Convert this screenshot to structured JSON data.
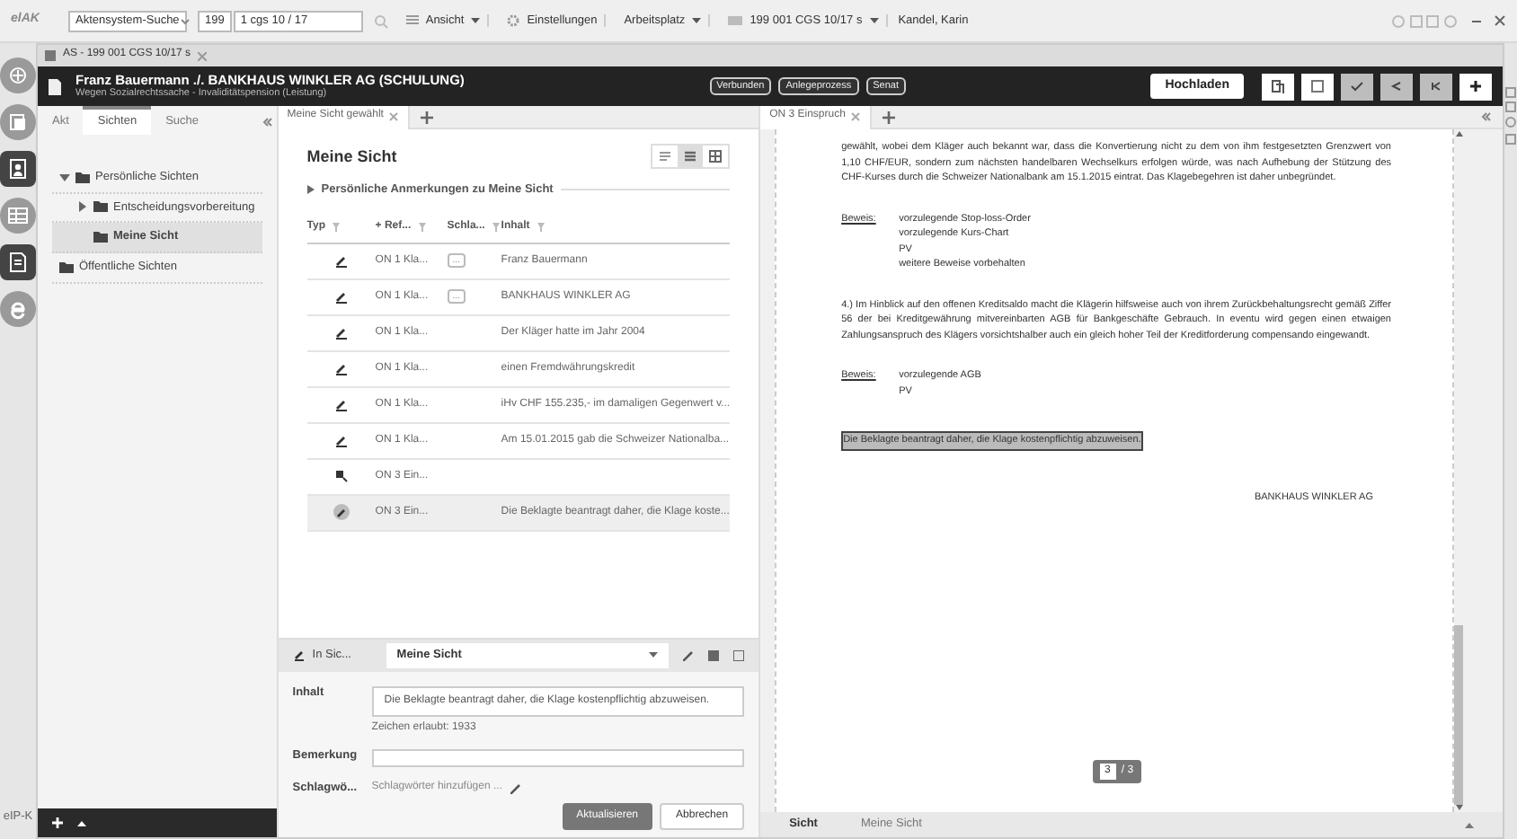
{
  "toolbar": {
    "logo": "elAK",
    "search_scope": "Aktensystem-Suche",
    "number": "199",
    "query": "1 cgs 10 / 17",
    "menus": [
      {
        "label": "Ansicht",
        "kind": "view",
        "dropdown": true
      },
      {
        "label": "Einstellungen",
        "kind": "settings",
        "dropdown": false
      },
      {
        "label": "Arbeitsplatz",
        "kind": "plain",
        "dropdown": true
      },
      {
        "label": "199 001 CGS 10/17 s",
        "kind": "file",
        "dropdown": true
      }
    ],
    "user": "Kandel, Karin"
  },
  "rail": {
    "items": [
      {
        "kind": "emblem",
        "selected": false
      },
      {
        "kind": "files",
        "selected": false
      },
      {
        "kind": "person",
        "selected": true
      },
      {
        "kind": "table",
        "selected": false
      },
      {
        "kind": "document",
        "selected": true
      },
      {
        "kind": "browser",
        "selected": false
      }
    ],
    "footer": "eIP-K"
  },
  "case_tab": "AS - 199 001 CGS 10/17 s",
  "header": {
    "title": "Franz Bauermann  ./.  BANKHAUS WINKLER AG (SCHULUNG)",
    "subtitle": "Wegen Sozialrechtssache - Invaliditätspension (Leistung)",
    "tags": [
      "Verbunden",
      "Anlegeprozess",
      "Senat"
    ],
    "upload": "Hochladen"
  },
  "left_panel": {
    "tabs": [
      {
        "label": "Akt",
        "selected": false
      },
      {
        "label": "Sichten",
        "selected": true
      },
      {
        "label": "Suche",
        "selected": false
      }
    ],
    "tree": [
      {
        "label": "Persönliche Sichten",
        "expandable": true,
        "expanded": true,
        "selected": false,
        "children": [
          {
            "label": "Entscheidungsvorbereitung",
            "expandable": true,
            "expanded": false,
            "selected": false
          },
          {
            "label": "Meine Sicht",
            "expandable": false,
            "selected": true
          }
        ]
      },
      {
        "label": "Öffentliche Sichten",
        "expandable": false,
        "selected": false
      }
    ]
  },
  "middle": {
    "tab": "Meine Sicht gewählt",
    "title": "Meine Sicht",
    "view_modes": [
      {
        "kind": "list",
        "selected": false
      },
      {
        "kind": "compact",
        "selected": true
      },
      {
        "kind": "grid",
        "selected": false
      }
    ],
    "section": "Persönliche Anmerkungen zu Meine Sicht",
    "columns": [
      "Typ",
      "+ Ref...",
      "Schla...",
      "Inhalt"
    ],
    "rows": [
      {
        "kind": "note",
        "ref": "ON 1 Kla...",
        "tag": "...",
        "content": "Franz Bauermann",
        "selected": false
      },
      {
        "kind": "note",
        "ref": "ON 1 Kla...",
        "tag": "...",
        "content": "BANKHAUS WINKLER AG",
        "selected": false
      },
      {
        "kind": "note",
        "ref": "ON 1 Kla...",
        "content": "Der Kläger hatte im Jahr 2004",
        "selected": false
      },
      {
        "kind": "note",
        "ref": "ON 1 Kla...",
        "content": "einen Fremdwährungskredit",
        "selected": false
      },
      {
        "kind": "note",
        "ref": "ON 1 Kla...",
        "content": "iHv CHF 155.235,- im damaligen Gegenwert v...",
        "selected": false
      },
      {
        "kind": "note",
        "ref": "ON 1 Kla...",
        "content": "Am 15.01.2015 gab die Schweizer Nationalba...",
        "selected": false
      },
      {
        "kind": "marker",
        "ref": "ON 3 Ein...",
        "selected": false
      },
      {
        "kind": "note",
        "ref": "ON 3 Ein...",
        "content": "Die Beklagte beantragt daher, die Klage koste...",
        "selected": true
      }
    ]
  },
  "editor": {
    "view_label": "In Sic...",
    "view": "Meine Sicht",
    "fields": [
      {
        "label": "Inhalt",
        "value": "Die Beklagte beantragt daher, die Klage kostenpflichtig abzuweisen.",
        "hint": "Zeichen erlaubt: 1933"
      },
      {
        "label": "Bemerkung"
      }
    ],
    "tags_label": "Schlagwö...",
    "tags_placeholder": "Schlagwörter hinzufügen ...",
    "buttons": [
      {
        "label": "Aktualisieren",
        "kind": "primary"
      },
      {
        "label": "Abbrechen",
        "kind": "secondary"
      }
    ]
  },
  "document": {
    "tab": "ON 3 Einspruch",
    "blocks": [
      {
        "kind": "para",
        "text": "gewählt, wobei dem Kläger auch bekannt war, dass die Konvertierung nicht zu dem von ihm festgesetzten Grenzwert von 1,10 CHF/EUR, sondern zum nächsten handelbaren Wechselkurs erfolgen würde, was nach Aufhebung der Stützung des CHF-Kurses durch die Schweizer Nationalbank am 15.1.2015 eintrat. Das Klagebegehren ist daher unbegründet."
      },
      {
        "kind": "evidence",
        "label": "Beweis:",
        "items": [
          "vorzulegende Stop-loss-Order",
          "vorzulegende Kurs-Chart",
          "PV",
          "weitere Beweise vorbehalten"
        ]
      },
      {
        "kind": "para",
        "text": "4.) Im Hinblick auf den offenen Kreditsaldo macht die Klägerin hilfsweise auch von ihrem Zurückbehaltungsrecht gemäß Ziffer 56 der bei Kreditgewährung mitvereinbarten AGB für Bankgeschäfte Gebrauch. In eventu wird gegen einen etwaigen Zahlungsanspruch des Klägers vorsichtshalber auch ein gleich hoher Teil der Kreditforderung compensando eingewandt."
      },
      {
        "kind": "evidence",
        "label": "Beweis:",
        "items": [
          "vorzulegende AGB",
          "PV"
        ]
      },
      {
        "kind": "highlight",
        "text": "Die Beklagte beantragt daher, die Klage kostenpflichtig abzuweisen."
      },
      {
        "kind": "signature",
        "text": "BANKHAUS WINKLER AG"
      }
    ],
    "page": "3",
    "pages": "/ 3"
  },
  "bottom_bar": {
    "label": "Sicht",
    "view": "Meine Sicht"
  }
}
